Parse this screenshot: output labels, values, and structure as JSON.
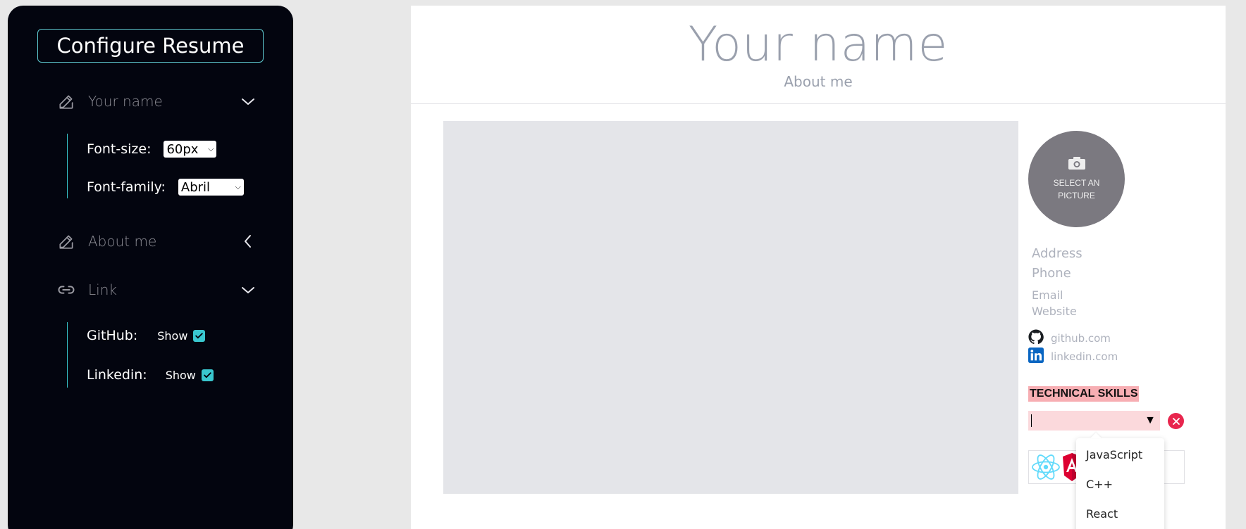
{
  "sidebar": {
    "title": "Configure Resume",
    "sections": {
      "name": {
        "label": "Your name",
        "icon": "edit-icon",
        "expanded": true
      },
      "about": {
        "label": "About me",
        "icon": "edit-icon",
        "expanded": false
      },
      "link": {
        "label": "Link",
        "icon": "link-icon",
        "expanded": true
      }
    },
    "name_options": {
      "font_size_label": "Font-size:",
      "font_size_value": "60px",
      "font_family_label": "Font-family:",
      "font_family_value": "Abril"
    },
    "link_options": {
      "github_label": "GitHub:",
      "github_show": "Show",
      "github_checked": true,
      "linkedin_label": "Linkedin:",
      "linkedin_show": "Show",
      "linkedin_checked": true
    }
  },
  "resume": {
    "name": "Your name",
    "about": "About me",
    "photo_label_1": "SELECT AN",
    "photo_label_2": "PICTURE",
    "address": "Address",
    "phone": "Phone",
    "email": "Email",
    "website": "Website",
    "github": "github.com",
    "linkedin": "linkedin.com",
    "skills_title": "TECHNICAL SKILLS",
    "skills_dropdown": [
      "JavaScript",
      "C++",
      "React"
    ]
  },
  "colors": {
    "accent": "#39c7cf",
    "sidebar_bg": "#03050f",
    "skills_highlight": "#f7aeb3",
    "remove": "#e8264e"
  }
}
